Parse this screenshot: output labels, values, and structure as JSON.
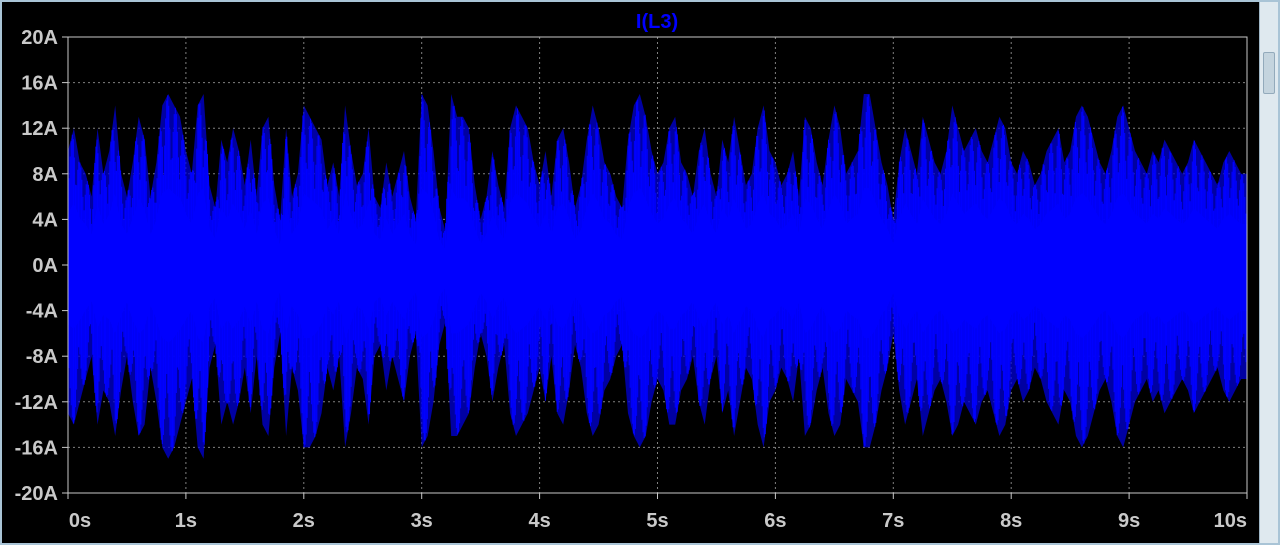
{
  "chart_data": {
    "type": "line",
    "title": "I(L3)",
    "xlabel": "",
    "ylabel": "",
    "xlim": [
      0,
      10
    ],
    "ylim": [
      -20,
      20
    ],
    "x_ticks": [
      "0s",
      "1s",
      "2s",
      "3s",
      "4s",
      "5s",
      "6s",
      "7s",
      "8s",
      "9s",
      "10s"
    ],
    "y_ticks": [
      "20A",
      "16A",
      "12A",
      "8A",
      "4A",
      "0A",
      "-4A",
      "-8A",
      "-12A",
      "-16A",
      "-20A"
    ],
    "grid": true,
    "series": [
      {
        "name": "I(L3)",
        "color": "#0000ff",
        "x": [
          0,
          0.05,
          0.1,
          0.15,
          0.2,
          0.25,
          0.3,
          0.35,
          0.4,
          0.45,
          0.5,
          0.55,
          0.6,
          0.65,
          0.7,
          0.75,
          0.8,
          0.85,
          0.9,
          0.95,
          1.0,
          1.05,
          1.1,
          1.15,
          1.2,
          1.25,
          1.3,
          1.35,
          1.4,
          1.45,
          1.5,
          1.55,
          1.6,
          1.65,
          1.7,
          1.75,
          1.8,
          1.85,
          1.9,
          1.95,
          2.0,
          2.05,
          2.1,
          2.15,
          2.2,
          2.25,
          2.3,
          2.35,
          2.4,
          2.45,
          2.5,
          2.55,
          2.6,
          2.65,
          2.7,
          2.75,
          2.8,
          2.85,
          2.9,
          2.95,
          3.0,
          3.05,
          3.1,
          3.15,
          3.2,
          3.25,
          3.3,
          3.35,
          3.4,
          3.45,
          3.5,
          3.55,
          3.6,
          3.65,
          3.7,
          3.75,
          3.8,
          3.85,
          3.9,
          3.95,
          4.0,
          4.05,
          4.1,
          4.15,
          4.2,
          4.25,
          4.3,
          4.35,
          4.4,
          4.45,
          4.5,
          4.55,
          4.6,
          4.65,
          4.7,
          4.75,
          4.8,
          4.85,
          4.9,
          4.95,
          5.0,
          5.05,
          5.1,
          5.15,
          5.2,
          5.25,
          5.3,
          5.35,
          5.4,
          5.45,
          5.5,
          5.55,
          5.6,
          5.65,
          5.7,
          5.75,
          5.8,
          5.85,
          5.9,
          5.95,
          6.0,
          6.05,
          6.1,
          6.15,
          6.2,
          6.25,
          6.3,
          6.35,
          6.4,
          6.45,
          6.5,
          6.55,
          6.6,
          6.65,
          6.7,
          6.75,
          6.8,
          6.85,
          6.9,
          6.95,
          7.0,
          7.05,
          7.1,
          7.15,
          7.2,
          7.25,
          7.3,
          7.35,
          7.4,
          7.45,
          7.5,
          7.55,
          7.6,
          7.65,
          7.7,
          7.75,
          7.8,
          7.85,
          7.9,
          7.95,
          8.0,
          8.05,
          8.1,
          8.15,
          8.2,
          8.25,
          8.3,
          8.35,
          8.4,
          8.45,
          8.5,
          8.55,
          8.6,
          8.65,
          8.7,
          8.75,
          8.8,
          8.85,
          8.9,
          8.95,
          9.0,
          9.05,
          9.1,
          9.15,
          9.2,
          9.25,
          9.3,
          9.35,
          9.4,
          9.45,
          9.5,
          9.55,
          9.6,
          9.65,
          9.7,
          9.75,
          9.8,
          9.85,
          9.9,
          9.95,
          10.0
        ],
        "y_max": [
          10,
          12,
          9,
          8,
          6,
          12,
          8,
          10,
          14,
          8,
          6,
          9,
          13,
          11,
          6,
          9,
          14,
          15,
          14,
          13,
          10,
          8,
          14,
          15,
          7,
          5,
          11,
          9,
          12,
          10,
          7,
          11,
          6,
          12,
          13,
          7,
          4,
          12,
          6,
          8,
          14,
          13,
          12,
          11,
          7,
          9,
          6,
          14,
          10,
          7,
          8,
          12,
          6,
          5,
          9,
          6,
          8,
          10,
          6,
          4,
          15,
          14,
          10,
          5,
          3,
          15,
          13,
          13,
          12,
          7,
          4,
          6,
          10,
          7,
          5,
          12,
          14,
          13,
          12,
          9,
          7,
          10,
          6,
          11,
          12,
          9,
          5,
          7,
          11,
          14,
          12,
          9,
          8,
          6,
          5,
          11,
          14,
          15,
          13,
          10,
          8,
          9,
          12,
          13,
          9,
          8,
          6,
          10,
          12,
          8,
          6,
          11,
          9,
          13,
          10,
          7,
          8,
          12,
          14,
          10,
          9,
          7,
          8,
          10,
          6,
          13,
          12,
          9,
          7,
          11,
          14,
          12,
          8,
          9,
          10,
          15,
          15,
          12,
          9,
          7,
          4,
          9,
          12,
          10,
          8,
          13,
          11,
          9,
          8,
          10,
          14,
          12,
          10,
          11,
          12,
          10,
          9,
          11,
          13,
          12,
          9,
          8,
          10,
          9,
          7,
          8,
          10,
          11,
          12,
          9,
          10,
          13,
          14,
          13,
          11,
          9,
          8,
          10,
          13,
          14,
          12,
          10,
          9,
          8,
          10,
          9,
          11,
          10,
          9,
          8,
          9,
          11,
          10,
          9,
          8,
          7,
          9,
          10,
          9,
          8,
          8
        ],
        "y_min": [
          -13,
          -14,
          -12,
          -10,
          -8,
          -14,
          -11,
          -12,
          -15,
          -11,
          -8,
          -12,
          -15,
          -14,
          -9,
          -12,
          -16,
          -17,
          -16,
          -14,
          -12,
          -10,
          -16,
          -17,
          -9,
          -7,
          -14,
          -12,
          -14,
          -12,
          -9,
          -13,
          -8,
          -14,
          -15,
          -9,
          -6,
          -15,
          -9,
          -11,
          -16,
          -16,
          -15,
          -13,
          -9,
          -11,
          -8,
          -16,
          -13,
          -9,
          -10,
          -14,
          -8,
          -7,
          -11,
          -8,
          -10,
          -12,
          -8,
          -6,
          -16,
          -15,
          -12,
          -7,
          -5,
          -15,
          -15,
          -14,
          -13,
          -9,
          -6,
          -8,
          -12,
          -9,
          -7,
          -13,
          -15,
          -14,
          -13,
          -11,
          -9,
          -12,
          -8,
          -13,
          -14,
          -11,
          -7,
          -9,
          -13,
          -15,
          -14,
          -11,
          -10,
          -8,
          -7,
          -13,
          -15,
          -16,
          -15,
          -12,
          -10,
          -11,
          -14,
          -14,
          -11,
          -10,
          -8,
          -12,
          -14,
          -10,
          -8,
          -13,
          -11,
          -15,
          -12,
          -9,
          -10,
          -14,
          -16,
          -12,
          -11,
          -9,
          -10,
          -12,
          -8,
          -15,
          -14,
          -11,
          -9,
          -13,
          -15,
          -14,
          -10,
          -11,
          -12,
          -16,
          -16,
          -14,
          -11,
          -9,
          -6,
          -11,
          -14,
          -12,
          -10,
          -15,
          -13,
          -11,
          -10,
          -12,
          -15,
          -14,
          -12,
          -13,
          -14,
          -12,
          -11,
          -13,
          -15,
          -14,
          -11,
          -10,
          -12,
          -11,
          -9,
          -10,
          -12,
          -13,
          -14,
          -11,
          -12,
          -15,
          -16,
          -15,
          -13,
          -11,
          -10,
          -12,
          -15,
          -16,
          -14,
          -12,
          -11,
          -10,
          -12,
          -11,
          -13,
          -12,
          -11,
          -10,
          -11,
          -13,
          -12,
          -11,
          -10,
          -9,
          -11,
          -12,
          -11,
          -10,
          -10
        ]
      }
    ]
  },
  "ui": {
    "window_border_color": "#a9c4d6",
    "plot_background": "#000000",
    "grid_color": "#808080",
    "tick_label_color": "#c9c9c9"
  }
}
